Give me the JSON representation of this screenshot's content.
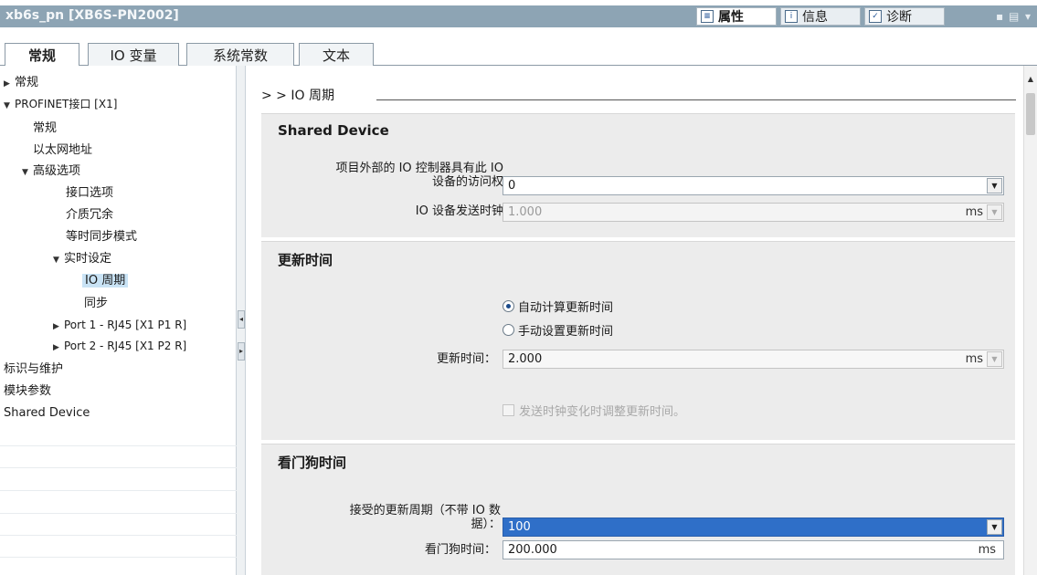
{
  "window": {
    "title": "xb6s_pn [XB6S-PN2002]",
    "inspector_tabs": [
      {
        "label": "属性",
        "icon": "properties-icon",
        "active": true
      },
      {
        "label": "信息",
        "icon": "info-icon",
        "active": false
      },
      {
        "label": "诊断",
        "icon": "diagnostics-icon",
        "active": false
      }
    ]
  },
  "subtabs": [
    {
      "label": "常规",
      "active": true
    },
    {
      "label": "IO 变量",
      "active": false
    },
    {
      "label": "系统常数",
      "active": false
    },
    {
      "label": "文本",
      "active": false
    }
  ],
  "nav": {
    "items": [
      {
        "label": "常规",
        "arrow": "▶"
      },
      {
        "label": "PROFINET接口 [X1]",
        "arrow": "▼"
      },
      {
        "label": "常规",
        "arrow": ""
      },
      {
        "label": "以太网地址",
        "arrow": ""
      },
      {
        "label": "高级选项",
        "arrow": "▼"
      },
      {
        "label": "接口选项",
        "arrow": ""
      },
      {
        "label": "介质冗余",
        "arrow": ""
      },
      {
        "label": "等时同步模式",
        "arrow": ""
      },
      {
        "label": "实时设定",
        "arrow": "▼"
      },
      {
        "label": "IO 周期",
        "arrow": ""
      },
      {
        "label": "同步",
        "arrow": ""
      },
      {
        "label": "Port 1 - RJ45 [X1 P1 R]",
        "arrow": "▶"
      },
      {
        "label": "Port 2 - RJ45 [X1 P2 R]",
        "arrow": "▶"
      },
      {
        "label": "标识与维护",
        "arrow": ""
      },
      {
        "label": "模块参数",
        "arrow": ""
      },
      {
        "label": "Shared Device",
        "arrow": ""
      }
    ]
  },
  "content": {
    "breadcrumb": "> >   IO 周期",
    "shared_device": {
      "title": "Shared Device",
      "access_label_line1": "项目外部的 IO 控制器具有此 IO",
      "access_label_line2": "设备的访问权",
      "access_value": "0",
      "send_clock_label": "IO 设备发送时钟",
      "send_clock_value": "1.000",
      "send_clock_unit": "ms"
    },
    "update_time": {
      "title": "更新时间",
      "radio_auto": "自动计算更新时间",
      "radio_manual": "手动设置更新时间",
      "auto_selected": true,
      "label": "更新时间：",
      "value": "2.000",
      "unit": "ms",
      "checkbox_label": "发送时钟变化时调整更新时间。"
    },
    "watchdog": {
      "title": "看门狗时间",
      "accepted_label_line1": "接受的更新周期（不带 IO 数",
      "accepted_label_line2": "据）：",
      "accepted_value": "100",
      "watchdog_label": "看门狗时间：",
      "watchdog_value": "200.000",
      "watchdog_unit": "ms"
    }
  }
}
